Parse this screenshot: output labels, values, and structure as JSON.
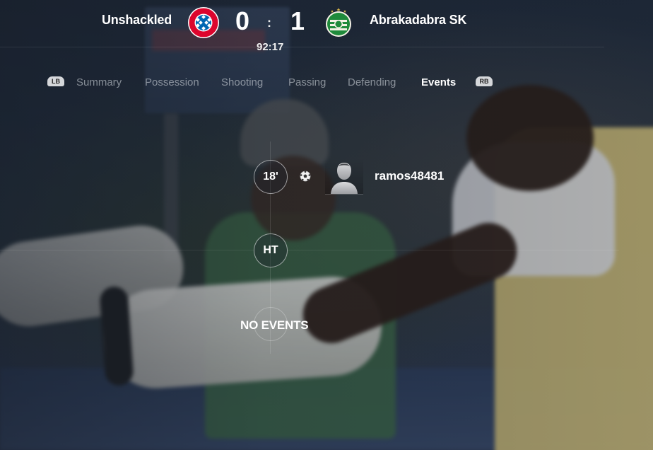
{
  "match": {
    "home": {
      "name": "Unshackled",
      "score": "0",
      "crest_icon": "fc-bayern-munchen-crest-icon",
      "crest_color": "#dc052d"
    },
    "away": {
      "name": "Abrakadabra SK",
      "score": "1",
      "crest_icon": "ferencvaros-crest-icon",
      "crest_color": "#1f8a3b"
    },
    "separator": ":",
    "clock": "92:17"
  },
  "tabs": {
    "left_bumper": "LB",
    "right_bumper": "RB",
    "items": [
      {
        "label": "Summary",
        "active": false
      },
      {
        "label": "Possession",
        "active": false
      },
      {
        "label": "Shooting",
        "active": false
      },
      {
        "label": "Passing",
        "active": false
      },
      {
        "label": "Defending",
        "active": false
      },
      {
        "label": "Events",
        "active": true
      }
    ]
  },
  "events": {
    "items": [
      {
        "minute": "18'",
        "type_icon": "soccer-ball-icon",
        "player": "ramos48481",
        "avatar_icon": "player-silhouette-icon"
      }
    ],
    "halftime_marker": "HT",
    "no_events_label": "NO EVENTS"
  }
}
